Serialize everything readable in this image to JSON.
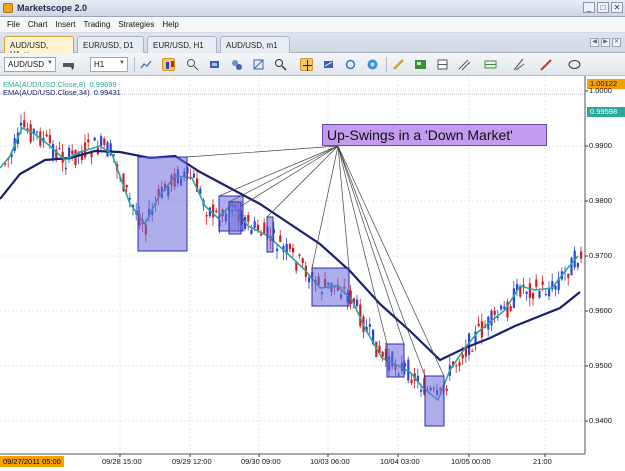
{
  "app": {
    "title": "Marketscope 2.0"
  },
  "window": {
    "minimize": "_",
    "maximize": "□",
    "close": "✕"
  },
  "menu": [
    "File",
    "Chart",
    "Insert",
    "Trading",
    "Strategies",
    "Help"
  ],
  "tabs": [
    {
      "label": "AUD/USD, H1",
      "active": true
    },
    {
      "label": "EUR/USD, D1",
      "active": false
    },
    {
      "label": "EUR/USD, H1",
      "active": false
    },
    {
      "label": "AUD/USD, m1",
      "active": false
    }
  ],
  "toolbar": {
    "symbol": "AUD/USD",
    "timeframe": "H1"
  },
  "indicators": [
    {
      "label": "EMA(AUD/USD.Close,8)",
      "value": "0.99699",
      "color": "#2aa89a"
    },
    {
      "label": "EMA(AUD/USD.Close,34)",
      "value": "0.99431",
      "color": "#1a1f6e"
    }
  ],
  "annotation": {
    "text": "Up-Swings in a 'Down Market'"
  },
  "price_axis": {
    "labels": [
      "1.0000",
      "0.9900",
      "0.9800",
      "0.9700",
      "0.9600",
      "0.9500",
      "0.9400"
    ],
    "top_badge": "1.00122",
    "current_badge": "0.99598"
  },
  "time_axis": {
    "labels": [
      "09/28 15:00",
      "09/29 12:00",
      "09/30 09:00",
      "10/03 06:00",
      "10/04 03:00",
      "10/05 00:00",
      "21:00"
    ],
    "cursor_badge": "09/27/2011 05:00"
  },
  "colors": {
    "bull": "#2b46d6",
    "bear": "#d11d1d",
    "ema_fast": "#2aa89a",
    "ema_slow": "#1a1f6e",
    "highlight": "#6b6bdd",
    "callout_bg": "#c39cf0",
    "accent": "#f5a100"
  }
}
